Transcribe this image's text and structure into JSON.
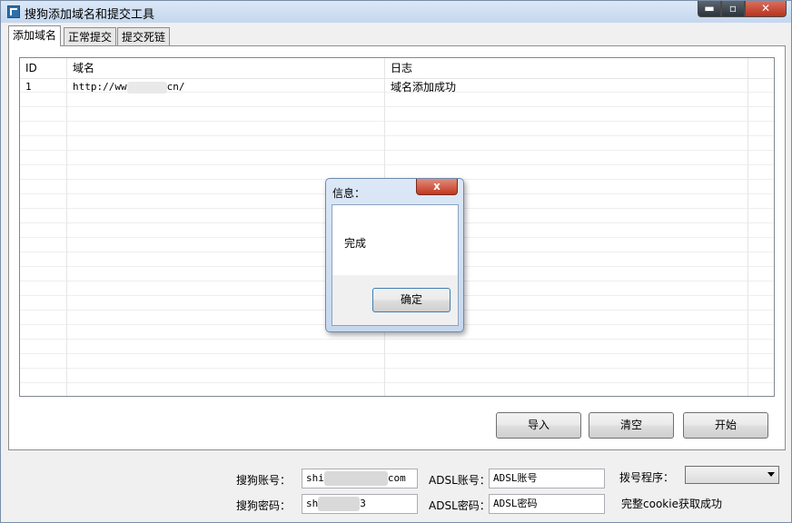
{
  "window": {
    "title": "搜狗添加域名和提交工具",
    "controls": {
      "minimize": "▬",
      "maximize": "▫",
      "close": "✕"
    }
  },
  "tabs": [
    {
      "label": "添加域名",
      "active": true
    },
    {
      "label": "正常提交",
      "active": false
    },
    {
      "label": "提交死链",
      "active": false
    }
  ],
  "grid": {
    "columns": [
      "ID",
      "域名",
      "日志"
    ],
    "rows": [
      {
        "id": "1",
        "domain_prefix": "http://ww",
        "domain_suffix": "cn/",
        "log": "域名添加成功"
      }
    ]
  },
  "buttons": {
    "import": "导入",
    "clear": "清空",
    "start": "开始"
  },
  "form": {
    "sogou_account_label": "搜狗账号：",
    "sogou_account_prefix": "shi",
    "sogou_account_suffix": "com",
    "sogou_password_label": "搜狗密码：",
    "sogou_password_prefix": "sh",
    "sogou_password_suffix": "3",
    "adsl_account_label": "ADSL账号：",
    "adsl_account_value": "ADSL账号",
    "adsl_password_label": "ADSL密码：",
    "adsl_password_value": "ADSL密码",
    "dialer_label": "拨号程序：",
    "dialer_value": "",
    "status_text": "完整cookie获取成功"
  },
  "dialog": {
    "title": "信息：",
    "message": "完成",
    "ok_label": "确定",
    "close_glyph": "x"
  },
  "colors": {
    "titlebar": "#c4d7ee",
    "close_red": "#c2381f",
    "border": "#8d8d8d"
  }
}
